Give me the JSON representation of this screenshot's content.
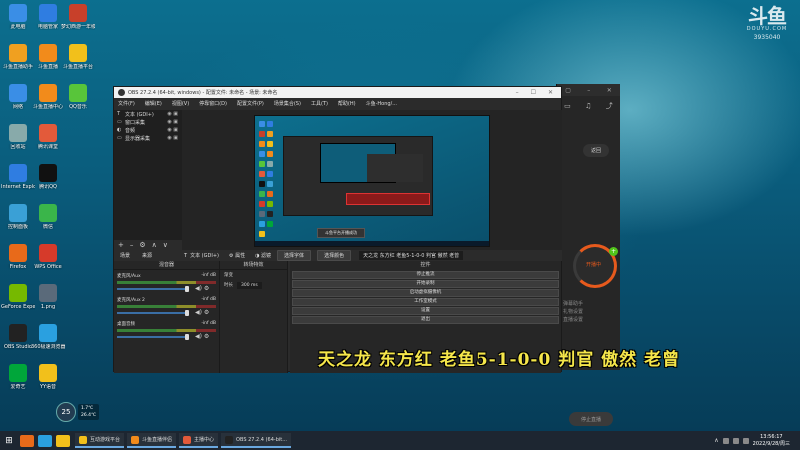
{
  "desktop_icons": [
    {
      "label": "此电脑",
      "icon": "computer-icon",
      "color": "#3a8ee6"
    },
    {
      "label": "电脑管家",
      "icon": "shield-icon",
      "color": "#2f7de1"
    },
    {
      "label": "梦幻西游一年级(...)",
      "icon": "game-icon",
      "color": "#c8402a"
    },
    {
      "label": "斗鱼直播助手",
      "icon": "fish-icon",
      "color": "#f0a020"
    },
    {
      "label": "斗鱼直播",
      "icon": "fish-icon",
      "color": "#f28b1b"
    },
    {
      "label": "斗鱼直播平台",
      "icon": "fish-icon",
      "color": "#f2c01b"
    },
    {
      "label": "网络",
      "icon": "network-icon",
      "color": "#3a8ee6"
    },
    {
      "label": "斗鱼直播中心",
      "icon": "fish-icon",
      "color": "#f28b1b"
    },
    {
      "label": "QQ音乐",
      "icon": "music-icon",
      "color": "#58c53a"
    },
    {
      "label": "回收站",
      "icon": "recycle-bin-icon",
      "color": "#8aa"
    },
    {
      "label": "腾讯课堂",
      "icon": "classroom-icon",
      "color": "#e35a3a"
    },
    {
      "label": "Internet Explorer",
      "icon": "ie-icon",
      "color": "#2f7de1"
    },
    {
      "label": "腾讯QQ",
      "icon": "qq-icon",
      "color": "#111"
    },
    {
      "label": "控制面板",
      "icon": "control-panel-icon",
      "color": "#3aa0d6"
    },
    {
      "label": "微信",
      "icon": "wechat-icon",
      "color": "#3ab54a"
    },
    {
      "label": "Firefox",
      "icon": "firefox-icon",
      "color": "#e86a1a"
    },
    {
      "label": "WPS Office",
      "icon": "wps-icon",
      "color": "#d63a2a"
    },
    {
      "label": "GeForce Experience",
      "icon": "nvidia-icon",
      "color": "#76b900"
    },
    {
      "label": "1.png",
      "icon": "image-icon",
      "color": "#5a6a7a"
    },
    {
      "label": "OBS Studio",
      "icon": "obs-icon",
      "color": "#222"
    },
    {
      "label": "360极速浏览器",
      "icon": "browser-icon",
      "color": "#2aa0e0"
    },
    {
      "label": "爱奇艺",
      "icon": "iqiyi-icon",
      "color": "#00a63a"
    },
    {
      "label": "YY语音",
      "icon": "yy-icon",
      "color": "#f2c01b"
    }
  ],
  "watermark": {
    "logo": "斗鱼",
    "sub": "DOUYU.COM",
    "room": "3935040"
  },
  "obs": {
    "title": "OBS 27.2.4 (64-bit, windows) - 配置文件: 未命名 - 场景: 未命名",
    "window_controls": {
      "minimize": "–",
      "maximize": "☐",
      "close": "✕"
    },
    "menu": [
      "文件(F)",
      "编辑(E)",
      "视图(V)",
      "停靠窗口(D)",
      "配置文件(P)",
      "场景集合(S)",
      "工具(T)",
      "帮助(H)",
      "斗鱼-Hong/..."
    ],
    "sources": [
      {
        "type": "T",
        "name": "文本 (GDI+)"
      },
      {
        "type": "▭",
        "name": "窗口采集"
      },
      {
        "type": "◐",
        "name": "音频"
      },
      {
        "type": "▭",
        "name": "显示器采集"
      }
    ],
    "source_toolbar": [
      "+",
      "–",
      "⚙",
      "∧",
      "∨"
    ],
    "preview_tooltip": "斗鱼平台开播成功",
    "scene_tabs": [
      "场景",
      "来源"
    ],
    "current_source": "文本 (GDI+)",
    "attr_btn": "属性",
    "filter_btn": "滤镜",
    "select_font_btn": "选择字体",
    "select_color_btn": "选择颜色",
    "text_field": "天之龙 东方红 老鱼5-1-0-0 判官 傲然 老曾",
    "mixer": {
      "header": "混音器",
      "channels": [
        {
          "name": "麦克风/Aux",
          "db": "-inf dB"
        },
        {
          "name": "麦克风/Aux 2",
          "db": "-inf dB"
        },
        {
          "name": "桌面音频",
          "db": "-inf dB"
        }
      ]
    },
    "transitions": {
      "header": "转场特效",
      "rows": [
        {
          "label": "渐变",
          "value": ""
        },
        {
          "label": "时长",
          "value": "300 ms"
        }
      ]
    },
    "controls": {
      "header": "控件",
      "buttons": [
        "停止推流",
        "开始录制",
        "启动虚拟摄像机",
        "工作室模式",
        "设置",
        "退出"
      ]
    }
  },
  "client": {
    "back_button": "返回",
    "ring_label": "开播中",
    "start_button": "停止直播",
    "menu_lines": [
      "弹幕助手",
      "礼物设置",
      "直播设置"
    ]
  },
  "overlay_text": "天之龙 东方红 老鱼5-1-0-0 判官 傲然 老曾",
  "weather": {
    "temp": "25",
    "line1": "1.7℃",
    "line2": "26.4℃"
  },
  "taskbar": {
    "start_icon": "⊞",
    "tasks": [
      {
        "label": "互动游戏平台",
        "color": "#f2c01b"
      },
      {
        "label": "斗鱼直播伴侣",
        "color": "#f28b1b"
      },
      {
        "label": "主播中心",
        "color": "#e35a3a"
      },
      {
        "label": "OBS 27.2.4 (64-bit...",
        "color": "#222"
      }
    ],
    "time": "13:56:17",
    "date": "2022/9/28/周三"
  }
}
